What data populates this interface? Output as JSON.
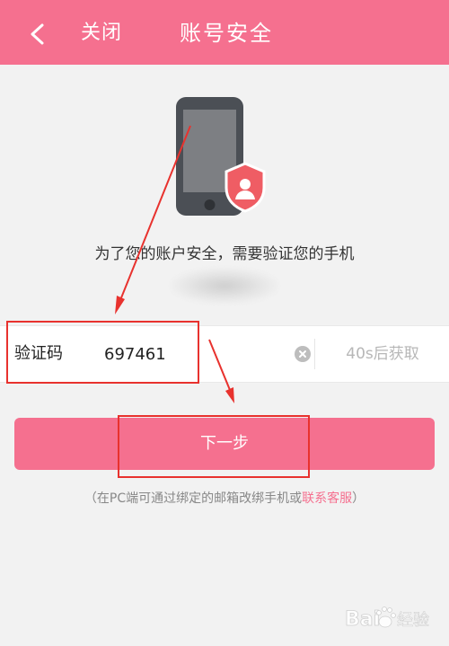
{
  "header": {
    "back_icon": "chevron-left-icon",
    "close_label": "关闭",
    "title": "账号安全"
  },
  "illustration": {
    "icon": "phone-shield-user-icon",
    "notice": "为了您的账户安全，需要验证您的手机"
  },
  "verification": {
    "label": "验证码",
    "value": "697461",
    "clear_icon": "clear-circle-icon",
    "resend_label": "40s后获取"
  },
  "next_button": {
    "label": "下一步"
  },
  "hint": {
    "prefix": "（在PC端可通过绑定的邮箱改绑手机或",
    "link": "联系客服",
    "suffix": "）"
  },
  "watermark": {
    "text": "Bai 经验"
  },
  "colors": {
    "brand": "#f5708f",
    "background": "#f2f2f2",
    "annotation": "#e8322e",
    "muted_text": "#b7b7b7"
  }
}
